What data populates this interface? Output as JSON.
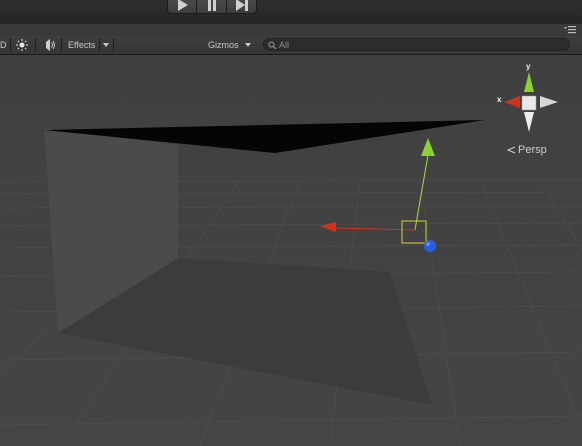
{
  "toolbar": {
    "mode_label": "D",
    "effects_label": "Effects",
    "gizmos_label": "Gizmos",
    "search_placeholder": "All"
  },
  "gizmo": {
    "x_label": "x",
    "y_label": "y",
    "projection_label": "Persp"
  },
  "icons": {
    "play": "play-icon",
    "pause": "pause-icon",
    "step": "step-icon",
    "sun": "sun-icon",
    "audio": "audio-icon",
    "search": "search-icon",
    "menu": "panel-menu-icon",
    "persp_arrow": "chevron-left-icon"
  },
  "colors": {
    "axis_x": "#d0321e",
    "axis_y": "#8bd232",
    "axis_z": "#2a5ee0",
    "selection_box": "#d8d23a",
    "background": "#3a3a3a"
  }
}
